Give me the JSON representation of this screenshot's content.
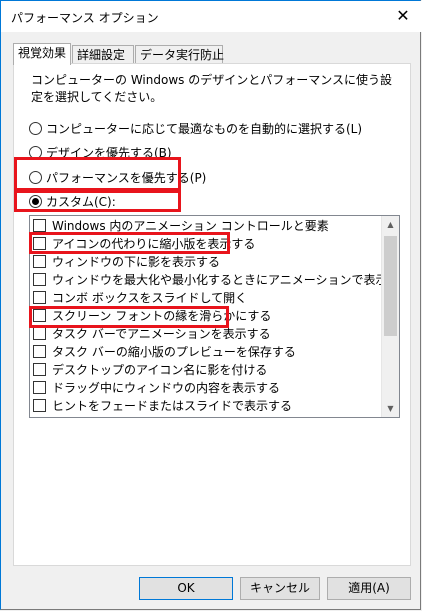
{
  "window": {
    "title": "パフォーマンス オプション",
    "close_icon": "close-icon"
  },
  "tabs": [
    {
      "label": "視覚効果",
      "active": true
    },
    {
      "label": "詳細設定",
      "active": false
    },
    {
      "label": "データ実行防止",
      "active": false
    }
  ],
  "description": "コンピューターの Windows のデザインとパフォーマンスに使う設定を選択してください。",
  "radios": [
    {
      "label": "コンピューターに応じて最適なものを自動的に選択する(L)",
      "checked": false
    },
    {
      "label": "デザインを優先する(B)",
      "checked": false
    },
    {
      "label": "パフォーマンスを優先する(P)",
      "checked": false
    },
    {
      "label": "カスタム(C):",
      "checked": true
    }
  ],
  "effects": [
    {
      "label": "Windows 内のアニメーション コントロールと要素",
      "checked": false
    },
    {
      "label": "アイコンの代わりに縮小版を表示する",
      "checked": false
    },
    {
      "label": "ウィンドウの下に影を表示する",
      "checked": false
    },
    {
      "label": "ウィンドウを最大化や最小化するときにアニメーションで表示する",
      "checked": false
    },
    {
      "label": "コンボ ボックスをスライドして開く",
      "checked": false
    },
    {
      "label": "スクリーン フォントの縁を滑らかにする",
      "checked": false
    },
    {
      "label": "タスク バーでアニメーションを表示する",
      "checked": false
    },
    {
      "label": "タスク バーの縮小版のプレビューを保存する",
      "checked": false
    },
    {
      "label": "デスクトップのアイコン名に影を付ける",
      "checked": false
    },
    {
      "label": "ドラッグ中にウィンドウの内容を表示する",
      "checked": false
    },
    {
      "label": "ヒントをフェードまたはスライドで表示する",
      "checked": false
    }
  ],
  "buttons": {
    "ok": "OK",
    "cancel": "キャンセル",
    "apply": "適用(A)"
  },
  "colors": {
    "highlight": "#e8141c",
    "accent": "#0078d7"
  }
}
